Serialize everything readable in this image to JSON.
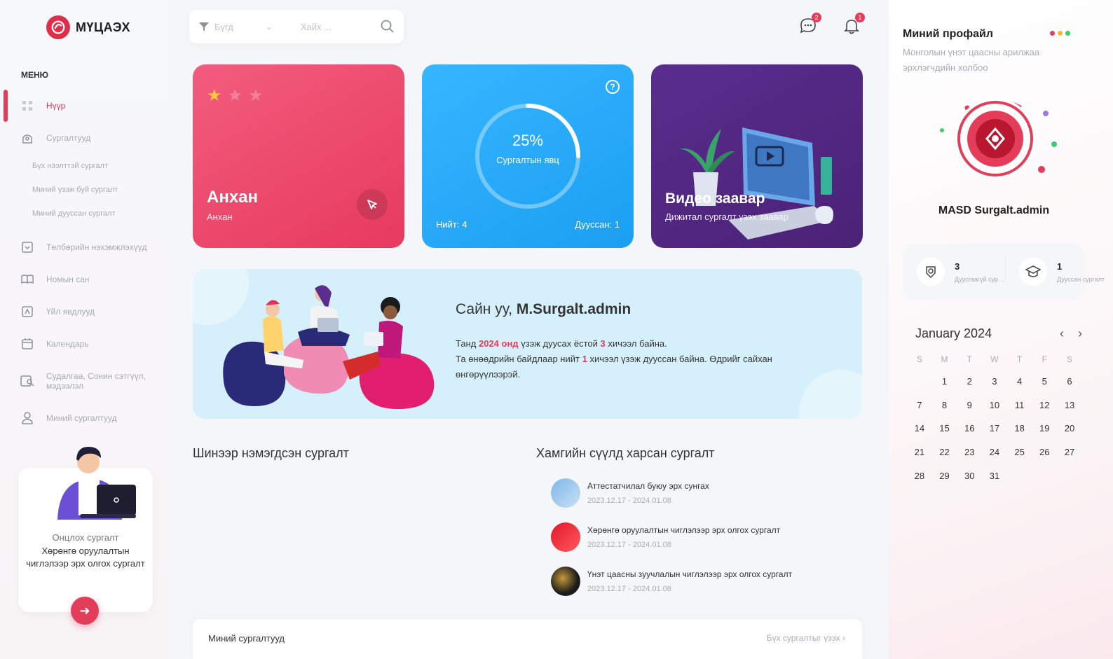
{
  "brand": {
    "name": "МҮЦАЭХ",
    "color": "#e02d4a"
  },
  "sidebar": {
    "menu_title": "МЕНЮ",
    "items": [
      {
        "label": "Нүүр",
        "icon": "grid-icon",
        "active": true
      },
      {
        "label": "Сургалтууд",
        "icon": "courses-icon"
      },
      {
        "label": "Бүх нээлттэй сургалт",
        "sub": true
      },
      {
        "label": "Миний үзэж буй сургалт",
        "sub": true
      },
      {
        "label": "Миний дууссан сургалт",
        "sub": true
      },
      {
        "label": "Төлбөрийн нэхэмжлэхүүд",
        "icon": "invoice-icon"
      },
      {
        "label": "Номын сан",
        "icon": "library-icon"
      },
      {
        "label": "Үйл явдлууд",
        "icon": "events-icon"
      },
      {
        "label": "Календарь",
        "icon": "calendar-icon"
      },
      {
        "label": "Судалгаа, Сонин сэтгүүл, мэдээлэл",
        "icon": "research-icon"
      },
      {
        "label": "Миний сургалтууд",
        "icon": "user-icon"
      }
    ],
    "promo": {
      "subtitle": "Онцлох сургалт",
      "title": "Хөрөнгө оруулалтын чиглэлээр эрх олгох сургалт"
    }
  },
  "topbar": {
    "filter_value": "Бүгд",
    "search_placeholder": "Хайх ...",
    "messages_count": "2",
    "notifications_count": "1"
  },
  "cards": {
    "level": {
      "title": "Анхан",
      "subtitle": "Анхан",
      "stars_filled": 1,
      "stars_total": 3
    },
    "progress": {
      "percent": "25%",
      "label": "Сургалтын явц",
      "fraction": 0.25,
      "total": "Нийт: 4",
      "done": "Дууссан: 1"
    },
    "video": {
      "title": "Видео заавар",
      "subtitle": "Дижитал сургалт үзэх заавар"
    }
  },
  "welcome": {
    "greeting": "Сайн уу,",
    "username": "M.Surgalt.admin",
    "line1_pre": "Танд",
    "line1_year": "2024 онд",
    "line1_mid": "үзэж дуусах ёстой",
    "line1_count": "3",
    "line1_post": "хичээл байна.",
    "line2_pre": "Та өнөөдрийн байдлаар нийт",
    "line2_count": "1",
    "line2_post": "хичээл үзэж дууссан байна. Өдрийг сайхан өнгөрүүлээрэй."
  },
  "sections": {
    "new_courses": "Шинээр нэмэгдсэн сургалт",
    "recent_courses": "Хамгийн сүүлд харсан сургалт"
  },
  "recent": [
    {
      "title": "Аттестатчилал буюу эрх сунгах",
      "date": "2023.12.17 - 2024.01.08"
    },
    {
      "title": "Хөрөнгө оруулалтын чиглэлээр эрх олгох сургалт",
      "date": "2023.12.17 - 2024.01.08"
    },
    {
      "title": "Үнэт цаасны зуучлалын чиглэлээр эрх олгох сургалт",
      "date": "2023.12.17 - 2024.01.08"
    }
  ],
  "my_courses": {
    "title": "Миний сургалтууд",
    "link": "Бүх сургалтыг үзэх"
  },
  "profile": {
    "title": "Миний профайл",
    "description": "Монголын үнэт цаасны арилжаа эрхлэгчдийн холбоо",
    "name": "MASD Surgalt.admin",
    "stats": [
      {
        "value": "3",
        "label": "Дуусгаагүй сургалт"
      },
      {
        "value": "1",
        "label": "Дууссан сургалт"
      }
    ]
  },
  "calendar": {
    "title": "January 2024",
    "dow": [
      "S",
      "M",
      "T",
      "W",
      "T",
      "F",
      "S"
    ],
    "start_offset": 1,
    "days": 31
  }
}
